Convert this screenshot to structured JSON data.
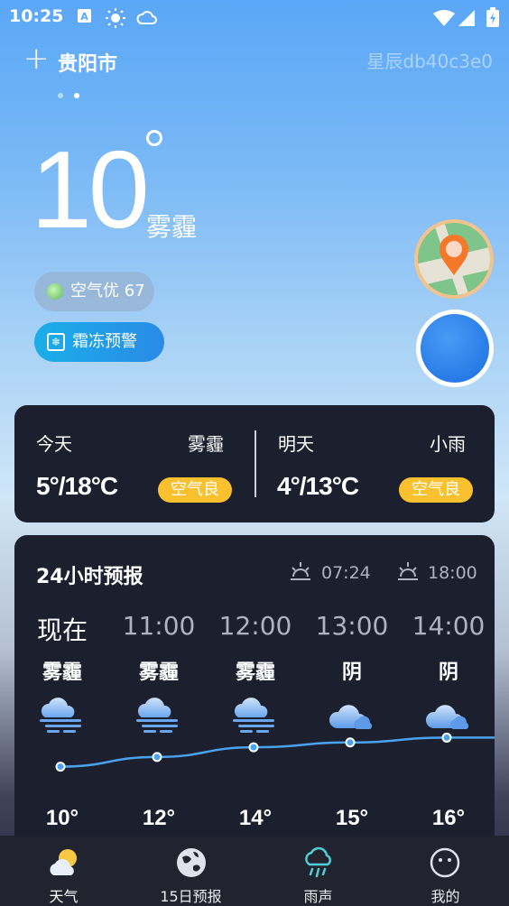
{
  "status_bar": {
    "time": "10:25"
  },
  "header": {
    "add_symbol": "+",
    "city": "贵阳市",
    "watermark": "星辰db40c3e0"
  },
  "current": {
    "temperature": "10",
    "condition": "雾霾",
    "air_quality": "空气优 67",
    "alert": "霜冻预警"
  },
  "summary": {
    "today": {
      "label": "今天",
      "condition": "雾霾",
      "range": "5°/18°C",
      "air": "空气良"
    },
    "tomorrow": {
      "label": "明天",
      "condition": "小雨",
      "range": "4°/13°C",
      "air": "空气良"
    }
  },
  "hourly": {
    "title": "24小时预报",
    "sunrise": "07:24",
    "sunset": "18:00",
    "hours": [
      "现在",
      "11:00",
      "12:00",
      "13:00",
      "14:00"
    ],
    "conditions": [
      "雾霾",
      "雾霾",
      "雾霾",
      "阴",
      "阴"
    ],
    "temps": [
      "10°",
      "12°",
      "14°",
      "15°",
      "16°"
    ],
    "temp_values": [
      10,
      12,
      14,
      15,
      16
    ],
    "icons": [
      "fog-icon",
      "fog-icon",
      "fog-icon",
      "cloudy-icon",
      "cloudy-icon"
    ]
  },
  "nav": {
    "items": [
      "天气",
      "15日预报",
      "雨声",
      "我的"
    ],
    "active": 0
  },
  "colors": {
    "card": "#1c1f2d",
    "pill": "#fbc02d",
    "line": "#4aa3f0"
  }
}
